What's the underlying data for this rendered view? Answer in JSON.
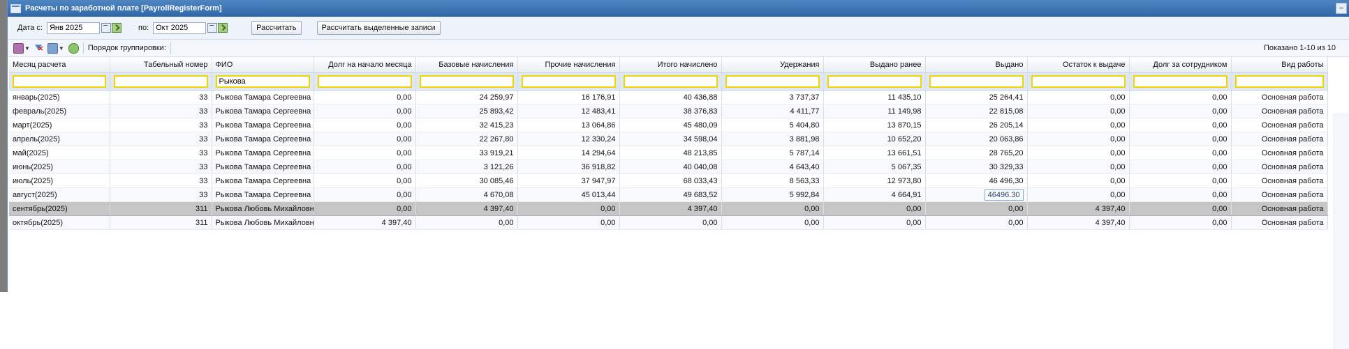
{
  "window": {
    "title": "Расчеты по заработной плате [PayrollRegisterForm]"
  },
  "dateFilter": {
    "from_label": "Дата с:",
    "from_value": "Янв 2025",
    "to_label": "по:",
    "to_value": "Окт 2025",
    "calc_label": "Рассчитать",
    "calc_selected_label": "Рассчитать выделенные записи"
  },
  "toolbar": {
    "grouping_label": "Порядок группировки:",
    "shown_text": "Показано 1-10 из 10"
  },
  "columns": [
    "Месяц расчета",
    "Табельный номер",
    "ФИО",
    "Долг на начало месяца",
    "Базовые начисления",
    "Прочие начисления",
    "Итого начислено",
    "Удержания",
    "Выдано ранее",
    "Выдано",
    "Остаток к выдаче",
    "Долг за сотрудником",
    "Вид работы"
  ],
  "filters": [
    "",
    "",
    "Рыкова",
    "",
    "",
    "",
    "",
    "",
    "",
    "",
    "",
    "",
    ""
  ],
  "rows": [
    [
      "январь(2025)",
      "33",
      "Рыкова Тамара Сергеевна",
      "0,00",
      "24 259,97",
      "16 176,91",
      "40 436,88",
      "3 737,37",
      "11 435,10",
      "25 264,41",
      "0,00",
      "0,00",
      "Основная работа"
    ],
    [
      "февраль(2025)",
      "33",
      "Рыкова Тамара Сергеевна",
      "0,00",
      "25 893,42",
      "12 483,41",
      "38 376,83",
      "4 411,77",
      "11 149,98",
      "22 815,08",
      "0,00",
      "0,00",
      "Основная работа"
    ],
    [
      "март(2025)",
      "33",
      "Рыкова Тамара Сергеевна",
      "0,00",
      "32 415,23",
      "13 064,86",
      "45 480,09",
      "5 404,80",
      "13 870,15",
      "26 205,14",
      "0,00",
      "0,00",
      "Основная работа"
    ],
    [
      "апрель(2025)",
      "33",
      "Рыкова Тамара Сергеевна",
      "0,00",
      "22 267,80",
      "12 330,24",
      "34 598,04",
      "3 881,98",
      "10 652,20",
      "20 063,86",
      "0,00",
      "0,00",
      "Основная работа"
    ],
    [
      "май(2025)",
      "33",
      "Рыкова Тамара Сергеевна",
      "0,00",
      "33 919,21",
      "14 294,64",
      "48 213,85",
      "5 787,14",
      "13 661,51",
      "28 765,20",
      "0,00",
      "0,00",
      "Основная работа"
    ],
    [
      "июнь(2025)",
      "33",
      "Рыкова Тамара Сергеевна",
      "0,00",
      "3 121,26",
      "36 918,82",
      "40 040,08",
      "4 643,40",
      "5 067,35",
      "30 329,33",
      "0,00",
      "0,00",
      "Основная работа"
    ],
    [
      "июль(2025)",
      "33",
      "Рыкова Тамара Сергеевна",
      "0,00",
      "30 085,46",
      "37 947,97",
      "68 033,43",
      "8 563,33",
      "12 973,80",
      "46 496,30",
      "0,00",
      "0,00",
      "Основная работа"
    ],
    [
      "август(2025)",
      "33",
      "Рыкова Тамара Сергеевна",
      "0,00",
      "4 670,08",
      "45 013,44",
      "49 683,52",
      "5 992,84",
      "4 664,91",
      "46496.30",
      "0,00",
      "0,00",
      "Основная работа"
    ],
    [
      "сентябрь(2025)",
      "311",
      "Рыкова Любовь Михайловна",
      "0,00",
      "4 397,40",
      "0,00",
      "4 397,40",
      "0,00",
      "0,00",
      "0,00",
      "4 397,40",
      "0,00",
      "Основная работа"
    ],
    [
      "октябрь(2025)",
      "311",
      "Рыкова Любовь Михайловна",
      "4 397,40",
      "0,00",
      "0,00",
      "0,00",
      "0,00",
      "0,00",
      "0,00",
      "4 397,40",
      "0,00",
      "Основная работа"
    ]
  ]
}
